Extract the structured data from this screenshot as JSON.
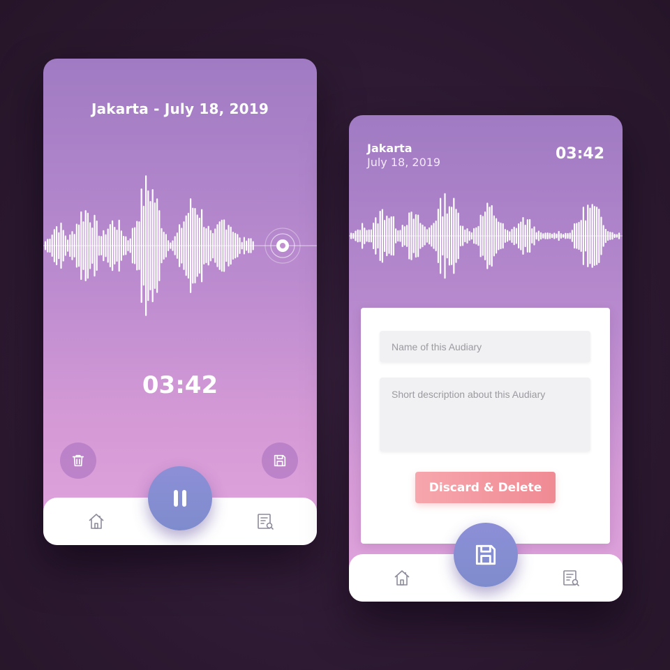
{
  "recording_screen": {
    "title": "Jakarta - July 18, 2019",
    "timer": "03:42",
    "icons": {
      "delete": "trash-icon",
      "save": "floppy-disk-icon",
      "pause": "pause-icon",
      "home": "home-icon",
      "library": "list-search-icon"
    }
  },
  "save_screen": {
    "city": "Jakarta",
    "date": "July 18, 2019",
    "timer": "03:42",
    "name_placeholder": "Name of this Audiary",
    "description_placeholder": "Short description about this Audiary",
    "discard_label": "Discard & Delete",
    "icons": {
      "save": "floppy-disk-icon",
      "home": "home-icon",
      "library": "list-search-icon"
    }
  },
  "colors": {
    "background": "#2e1a33",
    "gradient_top": "#a07bc3",
    "gradient_bottom": "#e0a3dc",
    "fab": "#8d8fd6",
    "discard": "#f08a93"
  }
}
